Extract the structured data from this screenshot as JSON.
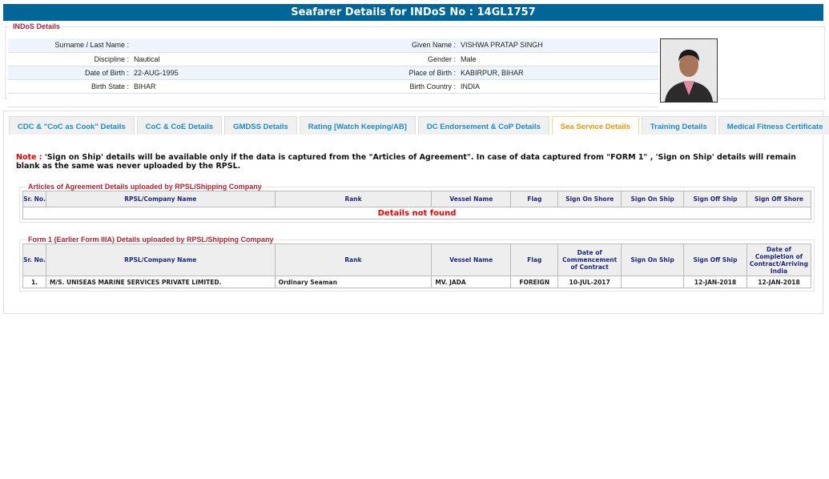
{
  "title": "Seafarer Details for INDoS No : 14GL1757",
  "indos": {
    "legend": "INDoS Details",
    "rows": [
      {
        "l1": "Surname / Last Name :",
        "v1": "",
        "l2": "Given Name :",
        "v2": "VISHWA PRATAP SINGH"
      },
      {
        "l1": "Discipline :",
        "v1": "Nautical",
        "l2": "Gender :",
        "v2": "Male"
      },
      {
        "l1": "Date of Birth :",
        "v1": "22-AUG-1995",
        "l2": "Place of Birth :",
        "v2": "KABIRPUR, BIHAR"
      },
      {
        "l1": "Birth State :",
        "v1": "BIHAR",
        "l2": "Birth Country :",
        "v2": "INDIA"
      }
    ]
  },
  "tabs": [
    "CDC & \"CoC as Cook\" Details",
    "CoC & CoE Details",
    "GMDSS Details",
    "Rating [Watch Keeping/AB]",
    "DC Endorsement & CoP Details",
    "Sea Service Details",
    "Training Details",
    "Medical Fitness Certificate"
  ],
  "note": {
    "label": "Note :",
    "text": " 'Sign on Ship' details will be available only if the data is captured from the \"Articles of Agreement\". In case of data captured from \"FORM 1\" , 'Sign on Ship' details will remain blank as the same was never uploaded by the RPSL."
  },
  "aoa": {
    "legend": "Articles of Agreement Details uploaded by RPSL/Shipping Company",
    "headers": [
      "Sr. No.",
      "RPSL/Company Name",
      "Rank",
      "Vessel Name",
      "Flag",
      "Sign On Shore",
      "Sign On Ship",
      "Sign Off Ship",
      "Sign Off Shore"
    ],
    "empty": "Details not found"
  },
  "form1": {
    "legend": "Form 1 (Earlier Form IIIA) Details uploaded by RPSL/Shipping Company",
    "headers": [
      "Sr. No.",
      "RPSL/Company Name",
      "Rank",
      "Vessel Name",
      "Flag",
      "Date of Commencement of Contract",
      "Sign On Ship",
      "Sign Off Ship",
      "Date of Completion of Contract/Arriving India"
    ],
    "rows": [
      [
        "1.",
        "M/S. UNISEAS MARINE SERVICES PRIVATE LIMITED.",
        "Ordinary Seaman",
        "MV. JADA",
        "FOREIGN",
        "10-JUL-2017",
        "",
        "12-JAN-2018",
        "12-JAN-2018"
      ]
    ]
  }
}
